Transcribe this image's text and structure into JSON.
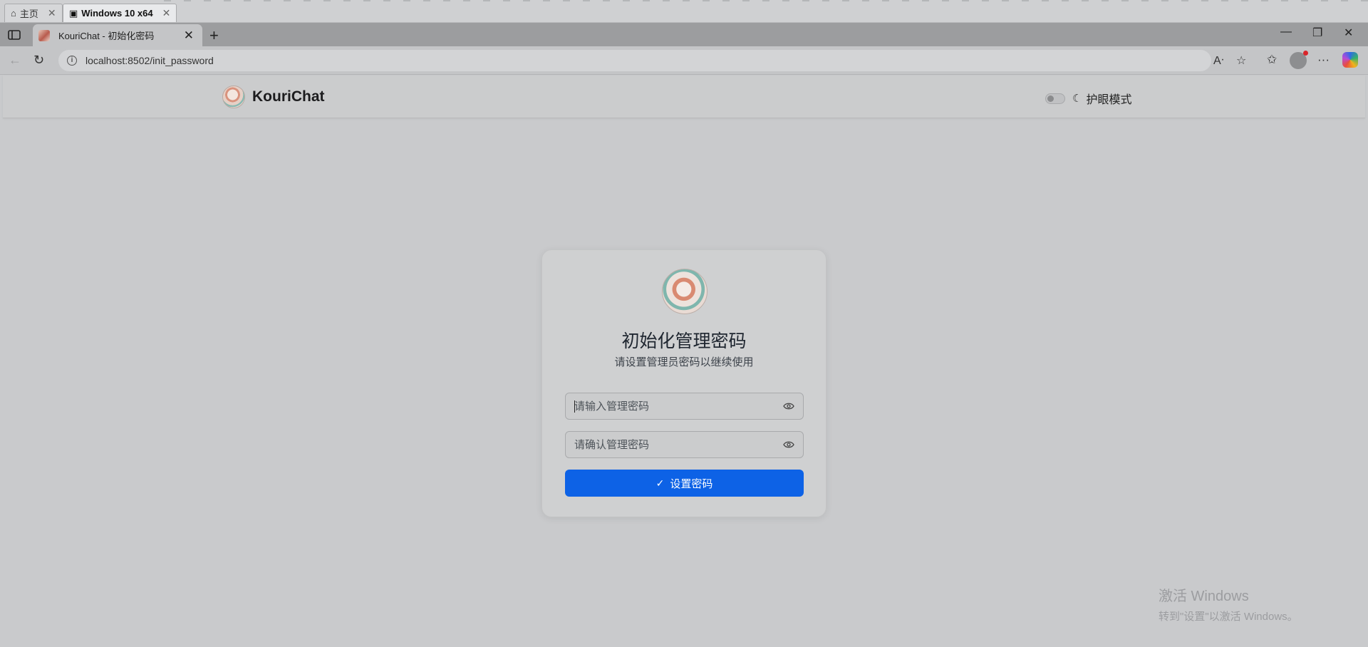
{
  "vm_tabs": [
    {
      "label": "主页",
      "icon": "home-icon"
    },
    {
      "label": "Windows 10 x64",
      "icon": "vm-icon"
    }
  ],
  "browser": {
    "tab_title": "KouriChat - 初始化密码",
    "url": "localhost:8502/init_password"
  },
  "header": {
    "brand": "KouriChat",
    "eye_mode_label": "护眼模式",
    "eye_mode_on": false
  },
  "card": {
    "title": "初始化管理密码",
    "subtitle": "请设置管理员密码以继续使用",
    "password_placeholder": "请输入管理密码",
    "confirm_placeholder": "请确认管理密码",
    "submit_label": "设置密码"
  },
  "watermark": {
    "line1": "激活 Windows",
    "line2": "转到\"设置\"以激活 Windows。"
  },
  "colors": {
    "primary": "#0d62e6",
    "page_bg": "#c9cacc"
  }
}
